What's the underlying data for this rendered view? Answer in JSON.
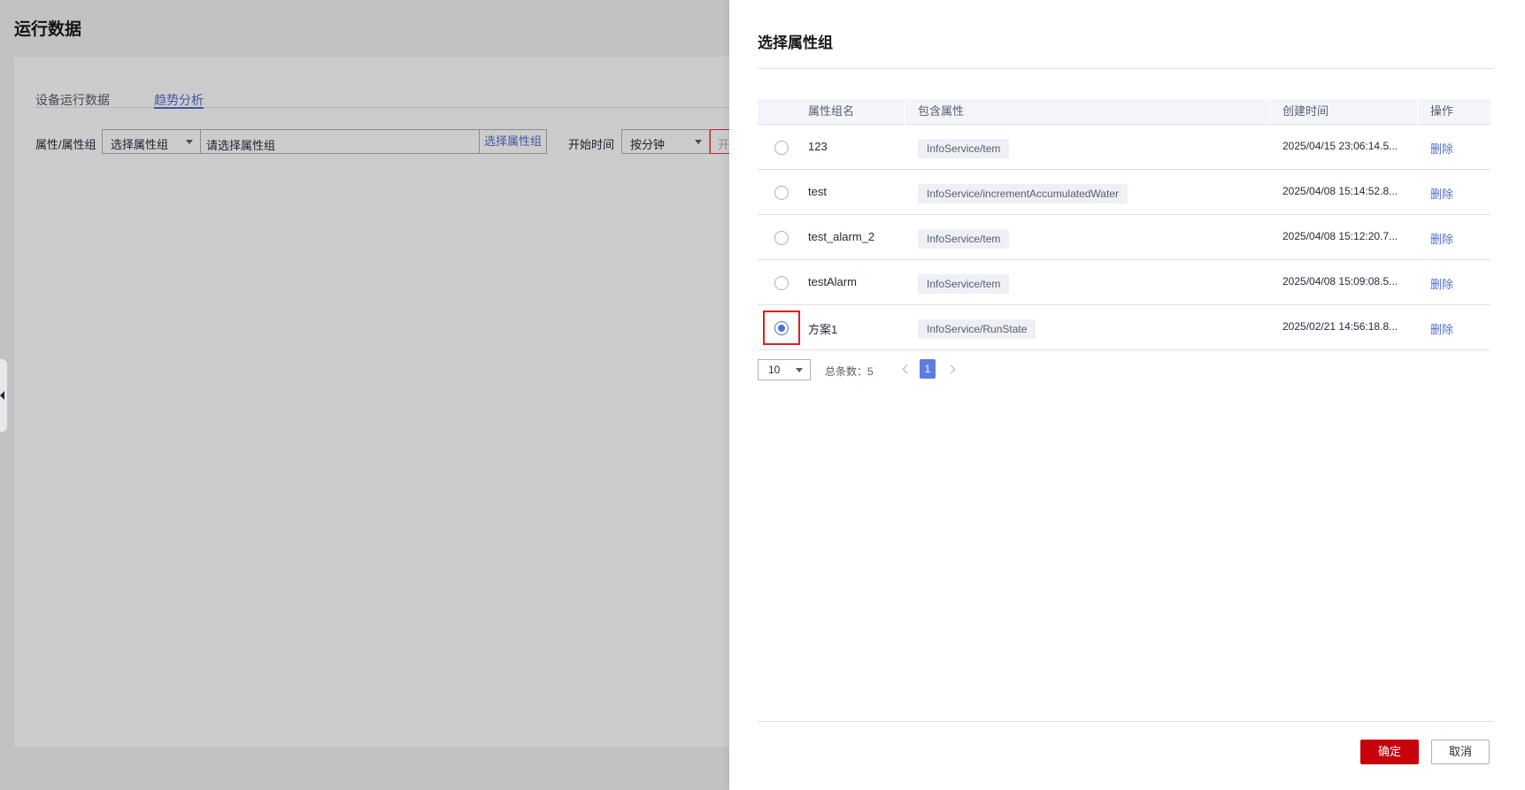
{
  "page": {
    "title": "运行数据",
    "tabs": [
      {
        "label": "设备运行数据",
        "active": false
      },
      {
        "label": "趋势分析",
        "active": true
      }
    ],
    "filters": {
      "group_label": "属性/属性组",
      "group_select": "选择属性组",
      "group_input_placeholder": "请选择属性组",
      "group_pick_link": "选择属性组",
      "start_label": "开始时间",
      "granularity": "按分钟",
      "date_placeholder": "开"
    }
  },
  "drawer": {
    "title": "选择属性组",
    "columns": [
      "属性组名",
      "包含属性",
      "创建时间",
      "操作"
    ],
    "rows": [
      {
        "name": "123",
        "attr": "InfoService/tem",
        "created": "2025/04/15 23:06:14.5...",
        "action": "删除",
        "selected": false
      },
      {
        "name": "test",
        "attr": "InfoService/incrementAccumulatedWater",
        "created": "2025/04/08 15:14:52.8...",
        "action": "删除",
        "selected": false
      },
      {
        "name": "test_alarm_2",
        "attr": "InfoService/tem",
        "created": "2025/04/08 15:12:20.7...",
        "action": "删除",
        "selected": false
      },
      {
        "name": "testAlarm",
        "attr": "InfoService/tem",
        "created": "2025/04/08 15:09:08.5...",
        "action": "删除",
        "selected": false
      },
      {
        "name": "方案1",
        "attr": "InfoService/RunState",
        "created": "2025/02/21 14:56:18.8...",
        "action": "删除",
        "selected": true
      }
    ],
    "pagination": {
      "page_size": "10",
      "total_text": "总条数：5",
      "current_page": "1"
    },
    "buttons": {
      "confirm": "确定",
      "cancel": "取消"
    },
    "colors": {
      "primary": "#c7000b",
      "link": "#526ecc",
      "highlight": "#e0201c"
    }
  }
}
